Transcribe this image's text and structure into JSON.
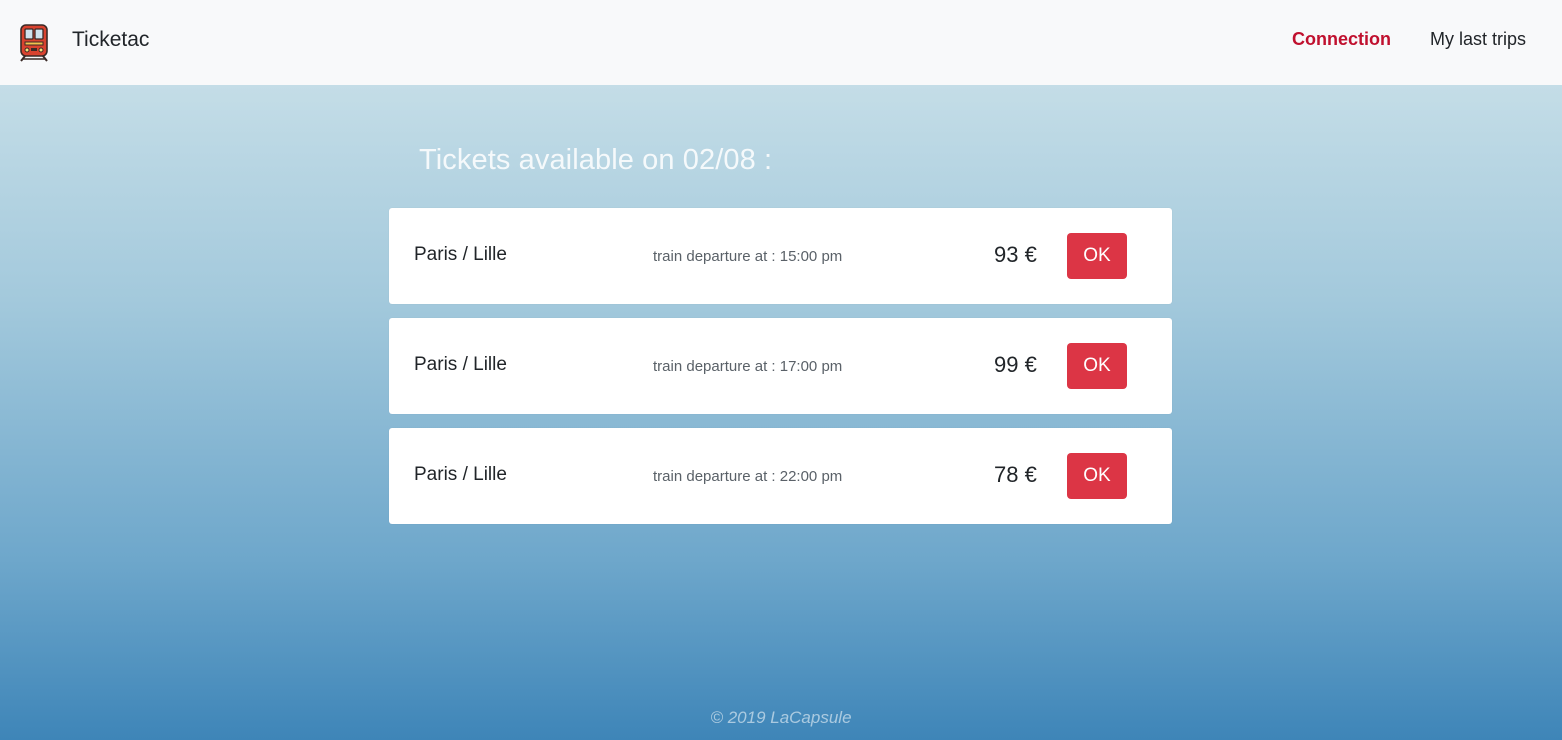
{
  "header": {
    "brand_name": "Ticketac",
    "brand_icon": "train-icon",
    "nav": {
      "connection_label": "Connection",
      "last_trips_label": "My last trips"
    },
    "accent_color": "#c0102e"
  },
  "main": {
    "title": "Tickets available on 02/08 :",
    "tickets": [
      {
        "route": "Paris / Lille",
        "departure": "train departure at : 15:00 pm",
        "price": "93 €",
        "button_label": "OK"
      },
      {
        "route": "Paris / Lille",
        "departure": "train departure at : 17:00 pm",
        "price": "99 €",
        "button_label": "OK"
      },
      {
        "route": "Paris / Lille",
        "departure": "train departure at : 22:00 pm",
        "price": "78 €",
        "button_label": "OK"
      }
    ],
    "button_color": "#dc3545"
  },
  "footer": {
    "copyright": "© 2019 LaCapsule"
  }
}
